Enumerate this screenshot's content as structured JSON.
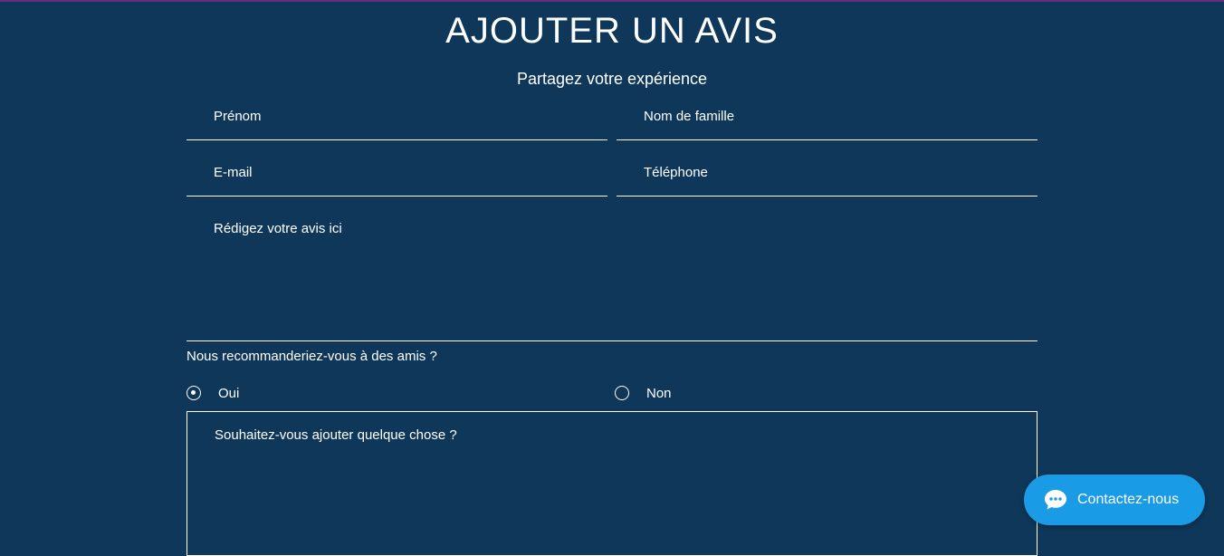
{
  "header": {
    "title": "AJOUTER UN AVIS",
    "subtitle": "Partagez votre expérience"
  },
  "form": {
    "first_name_placeholder": "Prénom",
    "last_name_placeholder": "Nom de famille",
    "email_placeholder": "E-mail",
    "phone_placeholder": "Téléphone",
    "review_placeholder": "Rédigez votre avis ici",
    "recommend_question": "Nous recommanderiez-vous à des amis ?",
    "options": [
      {
        "label": "Oui",
        "selected": true
      },
      {
        "label": "Non",
        "selected": false
      }
    ],
    "extra_placeholder": "Souhaitez-vous ajouter quelque chose ?"
  },
  "chat": {
    "label": "Contactez-nous",
    "icon": "chat-bubble-icon"
  },
  "colors": {
    "background": "#0e3759",
    "accent": "#1a9be6",
    "top_border": "#6a2a7a",
    "text": "#ffffff"
  }
}
